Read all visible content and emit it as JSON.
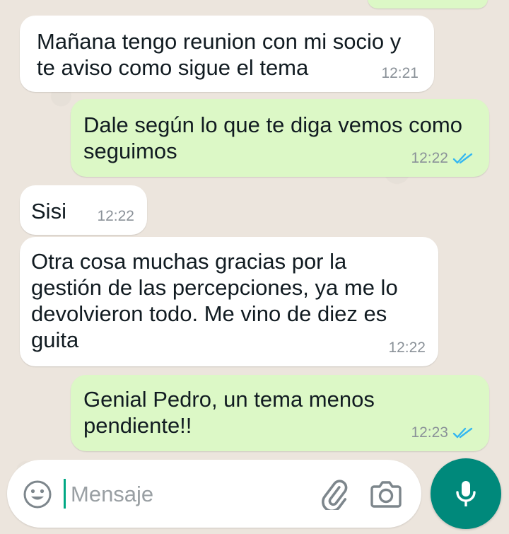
{
  "colors": {
    "incoming_bubble": "#ffffff",
    "outgoing_bubble": "#dcf8c6",
    "read_ticks": "#34b7f1",
    "mic_button": "#00897b",
    "wallpaper": "#ece5dd"
  },
  "messages": [
    {
      "direction": "incoming",
      "text": "Mañana tengo reunion con mi socio y\nte aviso como sigue el tema",
      "time": "12:21"
    },
    {
      "direction": "outgoing",
      "text": "Dale según lo que te diga vemos como\nseguimos",
      "time": "12:22",
      "status_icon": "double-check-read-icon"
    },
    {
      "direction": "incoming",
      "text": "Sisi",
      "time": "12:22"
    },
    {
      "direction": "incoming",
      "text": "Otra cosa muchas gracias por la\ngestión de las percepciones, ya me lo\ndevolvieron todo. Me vino de diez es\nguita",
      "time": "12:22"
    },
    {
      "direction": "outgoing",
      "text": "Genial Pedro, un tema menos\npendiente!!",
      "time": "12:23",
      "status_icon": "double-check-read-icon"
    }
  ],
  "composer": {
    "placeholder": "Mensaje",
    "value": "",
    "emoji_icon": "emoji-smile-icon",
    "attach_icon": "paperclip-icon",
    "camera_icon": "camera-icon",
    "mic_icon": "microphone-icon"
  }
}
